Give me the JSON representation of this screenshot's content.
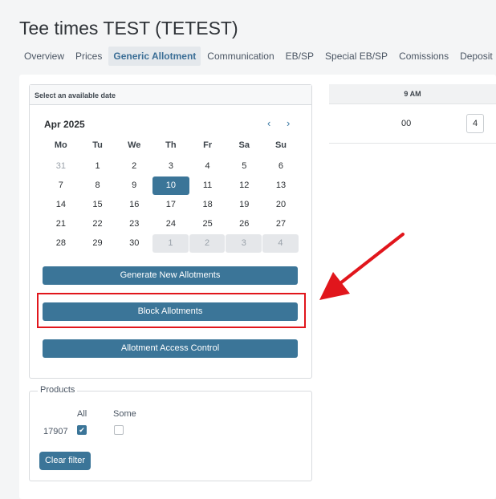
{
  "page": {
    "title": "Tee times TEST (TETEST)"
  },
  "tabs": [
    {
      "label": "Overview"
    },
    {
      "label": "Prices"
    },
    {
      "label": "Generic Allotment"
    },
    {
      "label": "Communication"
    },
    {
      "label": "EB/SP"
    },
    {
      "label": "Special EB/SP"
    },
    {
      "label": "Comissions"
    },
    {
      "label": "Deposit"
    }
  ],
  "calendar": {
    "header": "Select an available date",
    "month": "Apr 2025",
    "prev_icon": "‹",
    "next_icon": "›",
    "days_of_week": [
      "Mo",
      "Tu",
      "We",
      "Th",
      "Fr",
      "Sa",
      "Su"
    ],
    "weeks": [
      [
        "31",
        "1",
        "2",
        "3",
        "4",
        "5",
        "6"
      ],
      [
        "7",
        "8",
        "9",
        "10",
        "11",
        "12",
        "13"
      ],
      [
        "14",
        "15",
        "16",
        "17",
        "18",
        "19",
        "20"
      ],
      [
        "21",
        "22",
        "23",
        "24",
        "25",
        "26",
        "27"
      ],
      [
        "28",
        "29",
        "30",
        "1",
        "2",
        "3",
        "4"
      ]
    ],
    "selected_day": "10"
  },
  "actions": {
    "generate": "Generate New Allotments",
    "block": "Block Allotments",
    "access": "Allotment Access Control"
  },
  "allotment_table": {
    "hour_header": "9 AM",
    "minute": "00",
    "value": "4"
  },
  "products": {
    "legend": "Products",
    "col_all": "All",
    "col_some": "Some",
    "product_id": "17907",
    "all_checked": true,
    "some_checked": false,
    "clear_button": "Clear filter"
  },
  "colors": {
    "accent": "#3b7598",
    "highlight": "#e1161c"
  },
  "icons": [
    "chevron-left-icon",
    "chevron-right-icon",
    "checkmark-icon",
    "red-arrow-annotation"
  ]
}
